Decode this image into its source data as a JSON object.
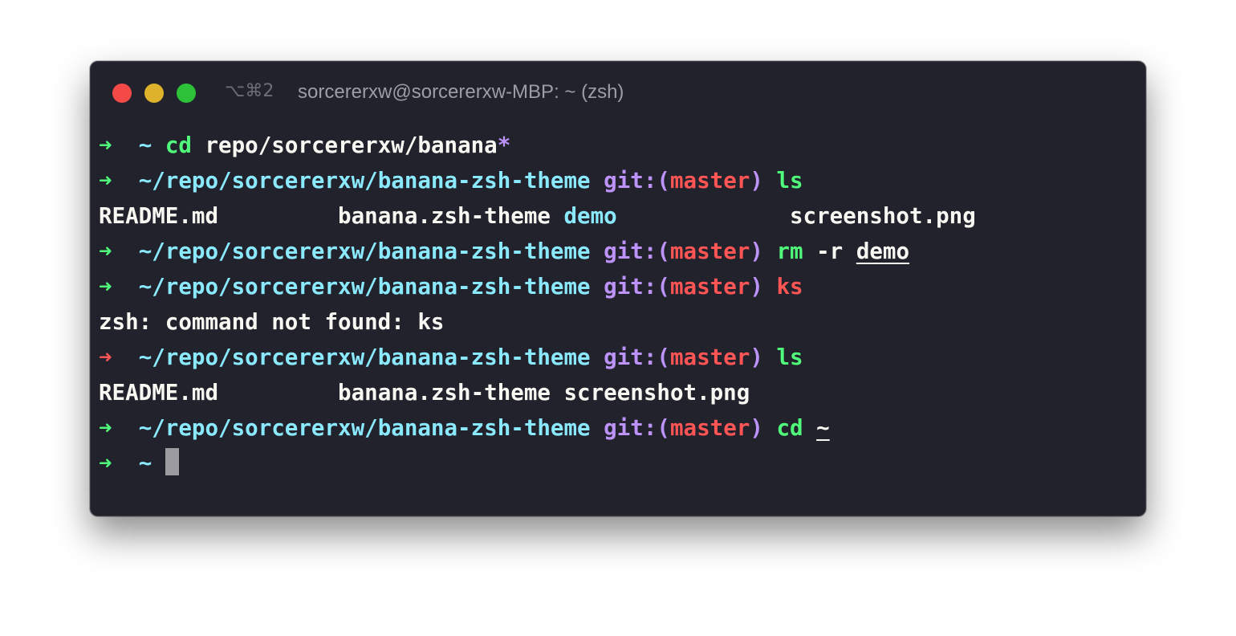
{
  "window": {
    "shortcut": "⌥⌘2",
    "title": "sorcererxw@sorcererxw-MBP: ~ (zsh)"
  },
  "terminal": {
    "arrow": "➜",
    "git_prefix": "git:(",
    "git_suffix": ")",
    "branch": "master",
    "lines": [
      {
        "home": "~",
        "cmd": "cd",
        "arg": "repo/sorcererxw/banana",
        "glob": "*"
      },
      {
        "path": "~/repo/sorcererxw/banana-zsh-theme",
        "cmd": "ls"
      },
      {
        "files": [
          "README.md",
          "banana.zsh-theme",
          "demo",
          "screenshot.png"
        ]
      },
      {
        "path": "~/repo/sorcererxw/banana-zsh-theme",
        "cmd": "rm",
        "flag": "-r",
        "arg": "demo"
      },
      {
        "path": "~/repo/sorcererxw/banana-zsh-theme",
        "cmd": "ks"
      },
      {
        "output": "zsh: command not found: ks"
      },
      {
        "path": "~/repo/sorcererxw/banana-zsh-theme",
        "cmd": "ls"
      },
      {
        "files": [
          "README.md",
          "banana.zsh-theme",
          "screenshot.png"
        ]
      },
      {
        "path": "~/repo/sorcererxw/banana-zsh-theme",
        "cmd": "cd",
        "arg": "~"
      },
      {
        "home": "~"
      }
    ]
  },
  "colors": {
    "background": "#21222c",
    "green": "#50fa7b",
    "cyan": "#8be9fd",
    "purple": "#bd93f9",
    "red": "#ff5555",
    "foreground": "#f8f8f2"
  }
}
